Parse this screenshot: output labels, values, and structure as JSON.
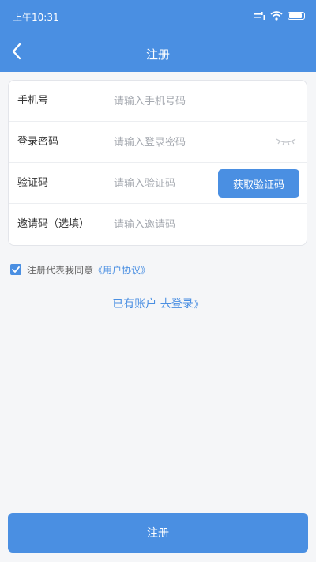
{
  "status_bar": {
    "time": "上午10:31"
  },
  "nav": {
    "title": "注册"
  },
  "form": {
    "rows": [
      {
        "label": "手机号",
        "placeholder": "请输入手机号码",
        "value": ""
      },
      {
        "label": "登录密码",
        "placeholder": "请输入登录密码",
        "value": ""
      },
      {
        "label": "验证码",
        "placeholder": "请输入验证码",
        "value": ""
      },
      {
        "label": "邀请码（选填）",
        "placeholder": "请输入邀请码",
        "value": ""
      }
    ],
    "get_code_label": "获取验证码"
  },
  "agreement": {
    "checked": true,
    "prefix": "注册代表我同意",
    "link": "《用户协议》"
  },
  "login_link": {
    "text": "已有账户 去登录",
    "arrows": "》"
  },
  "register_button": {
    "label": "注册"
  },
  "colors": {
    "accent": "#4a8fe2",
    "background": "#f5f6f8"
  },
  "icons": [
    "back-arrow-icon",
    "signal-icon",
    "wifi-icon",
    "battery-icon",
    "eye-closed-icon",
    "check-icon"
  ]
}
